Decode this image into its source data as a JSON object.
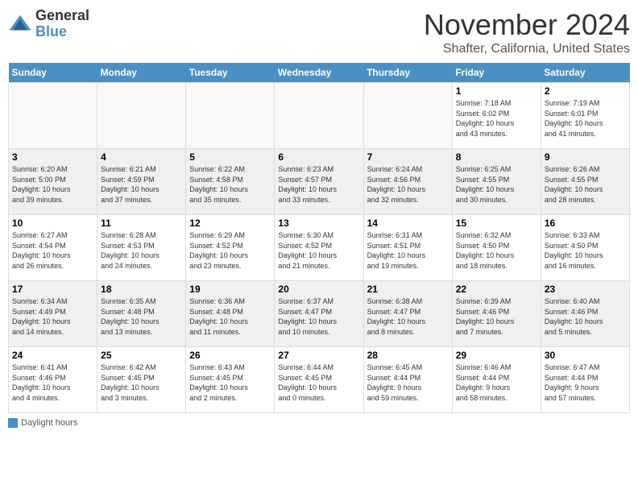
{
  "header": {
    "logo_general": "General",
    "logo_blue": "Blue",
    "month_title": "November 2024",
    "location": "Shafter, California, United States"
  },
  "weekdays": [
    "Sunday",
    "Monday",
    "Tuesday",
    "Wednesday",
    "Thursday",
    "Friday",
    "Saturday"
  ],
  "legend": {
    "label": "Daylight hours"
  },
  "weeks": [
    {
      "days": [
        {
          "num": "",
          "info": ""
        },
        {
          "num": "",
          "info": ""
        },
        {
          "num": "",
          "info": ""
        },
        {
          "num": "",
          "info": ""
        },
        {
          "num": "",
          "info": ""
        },
        {
          "num": "1",
          "info": "Sunrise: 7:18 AM\nSunset: 6:02 PM\nDaylight: 10 hours\nand 43 minutes."
        },
        {
          "num": "2",
          "info": "Sunrise: 7:19 AM\nSunset: 6:01 PM\nDaylight: 10 hours\nand 41 minutes."
        }
      ]
    },
    {
      "days": [
        {
          "num": "3",
          "info": "Sunrise: 6:20 AM\nSunset: 5:00 PM\nDaylight: 10 hours\nand 39 minutes."
        },
        {
          "num": "4",
          "info": "Sunrise: 6:21 AM\nSunset: 4:59 PM\nDaylight: 10 hours\nand 37 minutes."
        },
        {
          "num": "5",
          "info": "Sunrise: 6:22 AM\nSunset: 4:58 PM\nDaylight: 10 hours\nand 35 minutes."
        },
        {
          "num": "6",
          "info": "Sunrise: 6:23 AM\nSunset: 4:57 PM\nDaylight: 10 hours\nand 33 minutes."
        },
        {
          "num": "7",
          "info": "Sunrise: 6:24 AM\nSunset: 4:56 PM\nDaylight: 10 hours\nand 32 minutes."
        },
        {
          "num": "8",
          "info": "Sunrise: 6:25 AM\nSunset: 4:55 PM\nDaylight: 10 hours\nand 30 minutes."
        },
        {
          "num": "9",
          "info": "Sunrise: 6:26 AM\nSunset: 4:55 PM\nDaylight: 10 hours\nand 28 minutes."
        }
      ]
    },
    {
      "days": [
        {
          "num": "10",
          "info": "Sunrise: 6:27 AM\nSunset: 4:54 PM\nDaylight: 10 hours\nand 26 minutes."
        },
        {
          "num": "11",
          "info": "Sunrise: 6:28 AM\nSunset: 4:53 PM\nDaylight: 10 hours\nand 24 minutes."
        },
        {
          "num": "12",
          "info": "Sunrise: 6:29 AM\nSunset: 4:52 PM\nDaylight: 10 hours\nand 23 minutes."
        },
        {
          "num": "13",
          "info": "Sunrise: 6:30 AM\nSunset: 4:52 PM\nDaylight: 10 hours\nand 21 minutes."
        },
        {
          "num": "14",
          "info": "Sunrise: 6:31 AM\nSunset: 4:51 PM\nDaylight: 10 hours\nand 19 minutes."
        },
        {
          "num": "15",
          "info": "Sunrise: 6:32 AM\nSunset: 4:50 PM\nDaylight: 10 hours\nand 18 minutes."
        },
        {
          "num": "16",
          "info": "Sunrise: 6:33 AM\nSunset: 4:50 PM\nDaylight: 10 hours\nand 16 minutes."
        }
      ]
    },
    {
      "days": [
        {
          "num": "17",
          "info": "Sunrise: 6:34 AM\nSunset: 4:49 PM\nDaylight: 10 hours\nand 14 minutes."
        },
        {
          "num": "18",
          "info": "Sunrise: 6:35 AM\nSunset: 4:48 PM\nDaylight: 10 hours\nand 13 minutes."
        },
        {
          "num": "19",
          "info": "Sunrise: 6:36 AM\nSunset: 4:48 PM\nDaylight: 10 hours\nand 11 minutes."
        },
        {
          "num": "20",
          "info": "Sunrise: 6:37 AM\nSunset: 4:47 PM\nDaylight: 10 hours\nand 10 minutes."
        },
        {
          "num": "21",
          "info": "Sunrise: 6:38 AM\nSunset: 4:47 PM\nDaylight: 10 hours\nand 8 minutes."
        },
        {
          "num": "22",
          "info": "Sunrise: 6:39 AM\nSunset: 4:46 PM\nDaylight: 10 hours\nand 7 minutes."
        },
        {
          "num": "23",
          "info": "Sunrise: 6:40 AM\nSunset: 4:46 PM\nDaylight: 10 hours\nand 5 minutes."
        }
      ]
    },
    {
      "days": [
        {
          "num": "24",
          "info": "Sunrise: 6:41 AM\nSunset: 4:46 PM\nDaylight: 10 hours\nand 4 minutes."
        },
        {
          "num": "25",
          "info": "Sunrise: 6:42 AM\nSunset: 4:45 PM\nDaylight: 10 hours\nand 3 minutes."
        },
        {
          "num": "26",
          "info": "Sunrise: 6:43 AM\nSunset: 4:45 PM\nDaylight: 10 hours\nand 2 minutes."
        },
        {
          "num": "27",
          "info": "Sunrise: 6:44 AM\nSunset: 4:45 PM\nDaylight: 10 hours\nand 0 minutes."
        },
        {
          "num": "28",
          "info": "Sunrise: 6:45 AM\nSunset: 4:44 PM\nDaylight: 9 hours\nand 59 minutes."
        },
        {
          "num": "29",
          "info": "Sunrise: 6:46 AM\nSunset: 4:44 PM\nDaylight: 9 hours\nand 58 minutes."
        },
        {
          "num": "30",
          "info": "Sunrise: 6:47 AM\nSunset: 4:44 PM\nDaylight: 9 hours\nand 57 minutes."
        }
      ]
    }
  ]
}
